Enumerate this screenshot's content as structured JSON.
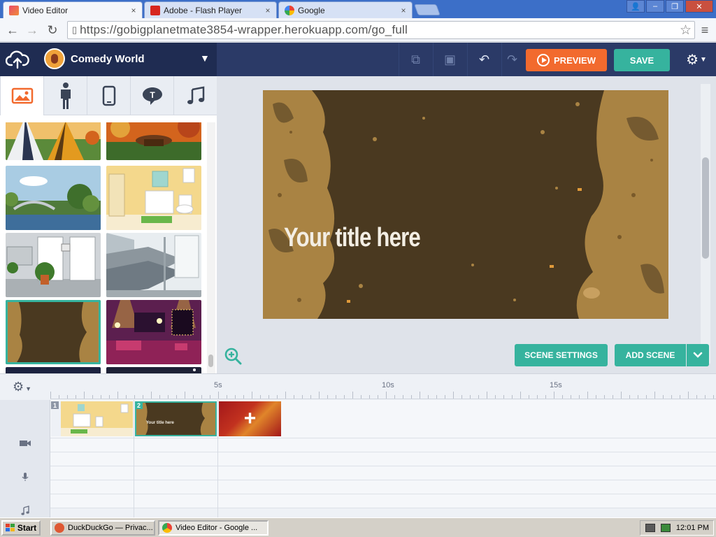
{
  "browser": {
    "tabs": [
      {
        "title": "Video Editor",
        "icon": "video-editor-favicon",
        "active": true
      },
      {
        "title": "Adobe - Flash Player",
        "icon": "adobe-favicon",
        "active": false
      },
      {
        "title": "Google",
        "icon": "google-favicon",
        "active": false
      }
    ],
    "tab_close": "×",
    "url": "https://gobigplanetmate3854-wrapper.herokuapp.com/go_full",
    "nav": {
      "back": "←",
      "forward": "→",
      "reload": "↻",
      "star": "☆",
      "menu": "≡"
    },
    "window": {
      "user": "👤",
      "minimize": "–",
      "restore": "❐",
      "close": "✕"
    }
  },
  "app": {
    "project_name": "Comedy World",
    "preview_label": "PREVIEW",
    "save_label": "SAVE",
    "category_tabs": [
      "background-image-icon",
      "character-icon",
      "prop-icon",
      "text-bubble-icon",
      "music-icon"
    ],
    "thumbnails": [
      {
        "name": "camping-tents",
        "colors": [
          "#f0c06b",
          "#5b8a3a"
        ]
      },
      {
        "name": "autumn-picnic",
        "colors": [
          "#d3641d",
          "#3d6b2a"
        ]
      },
      {
        "name": "park-bridge",
        "colors": [
          "#a9cce3",
          "#4f7a3b"
        ]
      },
      {
        "name": "bathroom",
        "colors": [
          "#f4d88c",
          "#ffffff"
        ]
      },
      {
        "name": "office-hallway",
        "colors": [
          "#d0d4d8",
          "#8c9396"
        ]
      },
      {
        "name": "train-interior",
        "colors": [
          "#e8edf0",
          "#6f7a83"
        ]
      },
      {
        "name": "dark-cave",
        "colors": [
          "#4a3920",
          "#a98343"
        ]
      },
      {
        "name": "nightclub",
        "colors": [
          "#5c1f4f",
          "#c73b6f"
        ]
      },
      {
        "name": "night-sky",
        "colors": [
          "#1c2340",
          "#3f4a76"
        ]
      },
      {
        "name": "space-scene",
        "colors": [
          "#1d2136",
          "#404866"
        ]
      }
    ],
    "stage_title": "Your title here",
    "scene_settings_label": "SCENE SETTINGS",
    "add_scene_label": "ADD SCENE",
    "colors": {
      "accent": "#36b39e",
      "preview": "#f26a2e",
      "header": "#2b3a67"
    }
  },
  "timeline": {
    "ticks": [
      {
        "label": "5s",
        "pos": 5
      },
      {
        "label": "10s",
        "pos": 10
      },
      {
        "label": "15s",
        "pos": 15
      }
    ],
    "clips": [
      {
        "number": "1",
        "thumb": "bathroom",
        "selected": false
      },
      {
        "number": "2",
        "thumb": "dark-cave",
        "selected": true
      }
    ],
    "clip2_caption": "Your title here",
    "add_clip_glyph": "+",
    "row_icons": [
      "video-camera-icon",
      "microphone-icon",
      "music-note-icon"
    ]
  },
  "taskbar": {
    "start_label": "Start",
    "items": [
      {
        "label": "DuckDuckGo — Privac...",
        "icon": "duckduckgo-icon",
        "active": false
      },
      {
        "label": "Video Editor - Google ...",
        "icon": "chrome-icon",
        "active": true
      }
    ],
    "clock": "12:01 PM"
  }
}
